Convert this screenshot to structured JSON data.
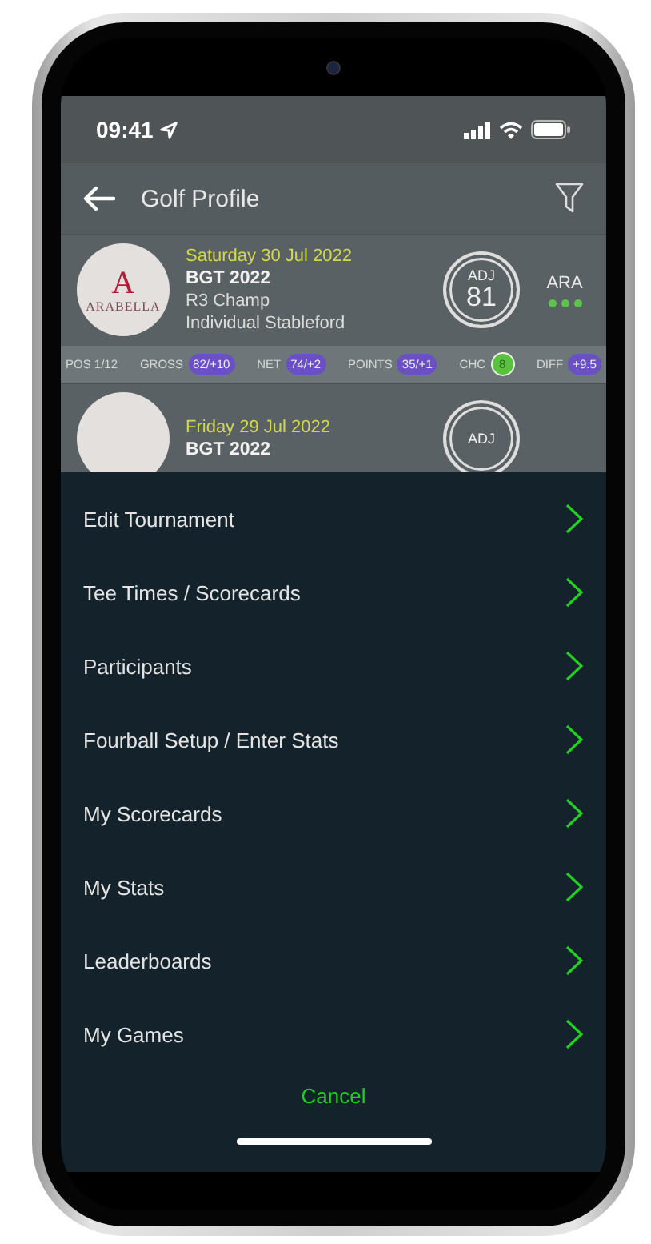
{
  "status_bar": {
    "time": "09:41"
  },
  "header": {
    "title": "Golf Profile"
  },
  "rounds": [
    {
      "date": "Saturday 30 Jul 2022",
      "title": "BGT 2022",
      "subtitle": "R3 Champ",
      "format": "Individual Stableford",
      "logo": "ARABELLA",
      "logo_letter": "A",
      "adj_label": "ADJ",
      "adj_value": "81",
      "club": "ARA",
      "stats": [
        {
          "label": "POS 1/12"
        },
        {
          "label": "GROSS",
          "value": "82/+10",
          "kind": "pill"
        },
        {
          "label": "NET",
          "value": "74/+2",
          "kind": "pill"
        },
        {
          "label": "POINTS",
          "value": "35/+1",
          "kind": "pill"
        },
        {
          "label": "CHC",
          "value": "8",
          "kind": "circle"
        },
        {
          "label": "DIFF",
          "value": "+9.5",
          "kind": "pill"
        }
      ]
    },
    {
      "date": "Friday 29 Jul 2022",
      "title": "BGT 2022",
      "adj_label": "ADJ"
    }
  ],
  "menu": {
    "items": [
      {
        "label": "Edit Tournament"
      },
      {
        "label": "Tee Times / Scorecards"
      },
      {
        "label": "Participants"
      },
      {
        "label": "Fourball Setup / Enter Stats"
      },
      {
        "label": "My Scorecards"
      },
      {
        "label": "My Stats"
      },
      {
        "label": "Leaderboards"
      },
      {
        "label": "My Games"
      }
    ],
    "cancel": "Cancel"
  }
}
